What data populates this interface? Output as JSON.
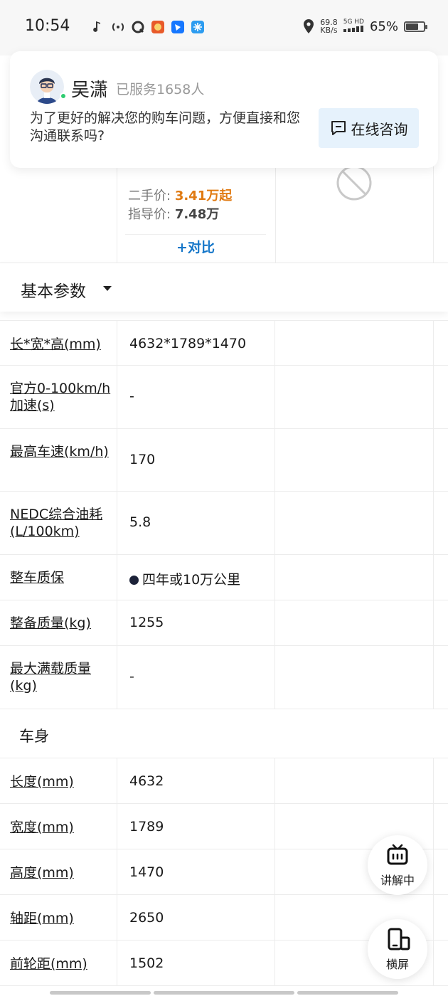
{
  "status_bar": {
    "time": "10:54",
    "net_speed": "69.8",
    "net_unit": "KB/s",
    "signal": "5G HD",
    "battery": "65%",
    "battery_level": 0.65
  },
  "consult_card": {
    "agent_name": "吴潇",
    "served": "已服务1658人",
    "message": "为了更好的解决您的购车问题，方便直接和您沟通联系吗?",
    "button_label": "在线咨询"
  },
  "car": {
    "used_price_label": "二手价:",
    "used_price": "3.41万起",
    "guide_price_label": "指导价:",
    "guide_price": "7.48万",
    "compare_label": "+对比"
  },
  "section": {
    "title": "基本参数"
  },
  "basic_rows": [
    {
      "label": "长*宽*高(mm)",
      "value": "4632*1789*1470"
    },
    {
      "label": "官方0-100km/h加速(s)",
      "value": "-"
    },
    {
      "label": "最高车速(km/h)",
      "value": "170"
    },
    {
      "label": "NEDC综合油耗(L/100km)",
      "value": "5.8"
    },
    {
      "label": "整车质保",
      "value": "四年或10万公里"
    },
    {
      "label": "整备质量(kg)",
      "value": "1255"
    },
    {
      "label": "最大满载质量(kg)",
      "value": "-"
    }
  ],
  "body_group": {
    "title": "车身",
    "rows": [
      {
        "label": "长度(mm)",
        "value": "4632"
      },
      {
        "label": "宽度(mm)",
        "value": "1789"
      },
      {
        "label": "高度(mm)",
        "value": "1470"
      },
      {
        "label": "轴距(mm)",
        "value": "2650"
      },
      {
        "label": "前轮距(mm)",
        "value": "1502"
      }
    ]
  },
  "fabs": {
    "explain_label": "讲解中",
    "landscape_label": "横屏"
  }
}
